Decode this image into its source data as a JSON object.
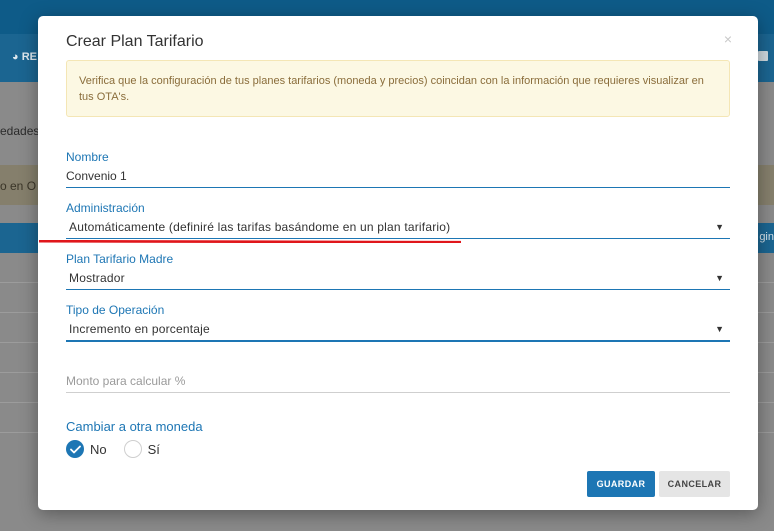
{
  "background": {
    "nav_left_label": "RE",
    "content_text": "edades",
    "alert_text": "o en O",
    "table_header_right": "gin"
  },
  "modal": {
    "title": "Crear Plan Tarifario",
    "close_glyph": "×",
    "info_message": "Verifica que la configuración de tus planes tarifarios (moneda y precios) coincidan con la información que requieres visualizar en tus OTA's."
  },
  "form": {
    "name": {
      "label": "Nombre",
      "value": "Convenio 1"
    },
    "administration": {
      "label": "Administración",
      "value": "Automáticamente (definiré las tarifas basándome en un plan tarifario)"
    },
    "parent_plan": {
      "label": "Plan Tarifario Madre",
      "value": "Mostrador"
    },
    "operation_type": {
      "label": "Tipo de Operación",
      "value": "Incremento en porcentaje"
    },
    "amount": {
      "placeholder": "Monto para calcular %"
    },
    "currency_change": {
      "label": "Cambiar a otra moneda",
      "options": [
        {
          "label": "No",
          "selected": true
        },
        {
          "label": "Sí",
          "selected": false
        }
      ]
    },
    "caret_glyph": "▼"
  },
  "actions": {
    "save_label": "GUARDAR",
    "cancel_label": "CANCELAR"
  },
  "colors": {
    "accent": "#1d76b4",
    "info_bg": "#fcf8e3",
    "info_text": "#8a6d3b",
    "annotation_red": "#e0161b"
  },
  "icons": {
    "radio_checked": "check-icon",
    "select_caret": "caret-down-icon",
    "close": "close-icon"
  }
}
